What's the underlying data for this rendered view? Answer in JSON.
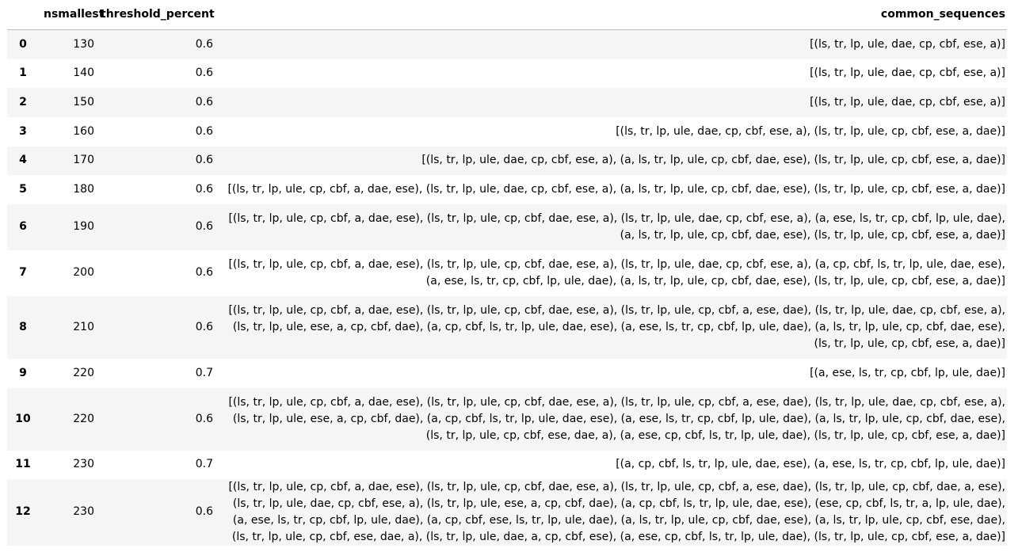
{
  "table": {
    "columns": [
      "",
      "nsmallest",
      "threshold_percent",
      "common_sequences"
    ],
    "rows": [
      {
        "index": "0",
        "nsmallest": "130",
        "threshold_percent": "0.6",
        "common_sequences": "[(ls, tr, lp, ule, dae, cp, cbf, ese, a)]"
      },
      {
        "index": "1",
        "nsmallest": "140",
        "threshold_percent": "0.6",
        "common_sequences": "[(ls, tr, lp, ule, dae, cp, cbf, ese, a)]"
      },
      {
        "index": "2",
        "nsmallest": "150",
        "threshold_percent": "0.6",
        "common_sequences": "[(ls, tr, lp, ule, dae, cp, cbf, ese, a)]"
      },
      {
        "index": "3",
        "nsmallest": "160",
        "threshold_percent": "0.6",
        "common_sequences": "[(ls, tr, lp, ule, dae, cp, cbf, ese, a), (ls, tr, lp, ule, cp, cbf, ese, a, dae)]"
      },
      {
        "index": "4",
        "nsmallest": "170",
        "threshold_percent": "0.6",
        "common_sequences": "[(ls, tr, lp, ule, dae, cp, cbf, ese, a), (a, ls, tr, lp, ule, cp, cbf, dae, ese), (ls, tr, lp, ule, cp, cbf, ese, a, dae)]"
      },
      {
        "index": "5",
        "nsmallest": "180",
        "threshold_percent": "0.6",
        "common_sequences": "[(ls, tr, lp, ule, cp, cbf, a, dae, ese), (ls, tr, lp, ule, dae, cp, cbf, ese, a), (a, ls, tr, lp, ule, cp, cbf, dae, ese), (ls, tr, lp, ule, cp, cbf, ese, a, dae)]"
      },
      {
        "index": "6",
        "nsmallest": "190",
        "threshold_percent": "0.6",
        "common_sequences": "[(ls, tr, lp, ule, cp, cbf, a, dae, ese), (ls, tr, lp, ule, cp, cbf, dae, ese, a), (ls, tr, lp, ule, dae, cp, cbf, ese, a), (a, ese, ls, tr, cp, cbf, lp, ule, dae), (a, ls, tr, lp, ule, cp, cbf, dae, ese), (ls, tr, lp, ule, cp, cbf, ese, a, dae)]"
      },
      {
        "index": "7",
        "nsmallest": "200",
        "threshold_percent": "0.6",
        "common_sequences": "[(ls, tr, lp, ule, cp, cbf, a, dae, ese), (ls, tr, lp, ule, cp, cbf, dae, ese, a), (ls, tr, lp, ule, dae, cp, cbf, ese, a), (a, cp, cbf, ls, tr, lp, ule, dae, ese), (a, ese, ls, tr, cp, cbf, lp, ule, dae), (a, ls, tr, lp, ule, cp, cbf, dae, ese), (ls, tr, lp, ule, cp, cbf, ese, a, dae)]"
      },
      {
        "index": "8",
        "nsmallest": "210",
        "threshold_percent": "0.6",
        "common_sequences": "[(ls, tr, lp, ule, cp, cbf, a, dae, ese), (ls, tr, lp, ule, cp, cbf, dae, ese, a), (ls, tr, lp, ule, cp, cbf, a, ese, dae), (ls, tr, lp, ule, dae, cp, cbf, ese, a), (ls, tr, lp, ule, ese, a, cp, cbf, dae), (a, cp, cbf, ls, tr, lp, ule, dae, ese), (a, ese, ls, tr, cp, cbf, lp, ule, dae), (a, ls, tr, lp, ule, cp, cbf, dae, ese), (ls, tr, lp, ule, cp, cbf, ese, a, dae)]"
      },
      {
        "index": "9",
        "nsmallest": "220",
        "threshold_percent": "0.7",
        "common_sequences": "[(a, ese, ls, tr, cp, cbf, lp, ule, dae)]"
      },
      {
        "index": "10",
        "nsmallest": "220",
        "threshold_percent": "0.6",
        "common_sequences": "[(ls, tr, lp, ule, cp, cbf, a, dae, ese), (ls, tr, lp, ule, cp, cbf, dae, ese, a), (ls, tr, lp, ule, cp, cbf, a, ese, dae), (ls, tr, lp, ule, dae, cp, cbf, ese, a), (ls, tr, lp, ule, ese, a, cp, cbf, dae), (a, cp, cbf, ls, tr, lp, ule, dae, ese), (a, ese, ls, tr, cp, cbf, lp, ule, dae), (a, ls, tr, lp, ule, cp, cbf, dae, ese), (ls, tr, lp, ule, cp, cbf, ese, dae, a), (a, ese, cp, cbf, ls, tr, lp, ule, dae), (ls, tr, lp, ule, cp, cbf, ese, a, dae)]"
      },
      {
        "index": "11",
        "nsmallest": "230",
        "threshold_percent": "0.7",
        "common_sequences": "[(a, cp, cbf, ls, tr, lp, ule, dae, ese), (a, ese, ls, tr, cp, cbf, lp, ule, dae)]"
      },
      {
        "index": "12",
        "nsmallest": "230",
        "threshold_percent": "0.6",
        "common_sequences": "[(ls, tr, lp, ule, cp, cbf, a, dae, ese), (ls, tr, lp, ule, cp, cbf, dae, ese, a), (ls, tr, lp, ule, cp, cbf, a, ese, dae), (ls, tr, lp, ule, cp, cbf, dae, a, ese), (ls, tr, lp, ule, dae, cp, cbf, ese, a), (ls, tr, lp, ule, ese, a, cp, cbf, dae), (a, cp, cbf, ls, tr, lp, ule, dae, ese), (ese, cp, cbf, ls, tr, a, lp, ule, dae), (a, ese, ls, tr, cp, cbf, lp, ule, dae), (a, cp, cbf, ese, ls, tr, lp, ule, dae), (a, ls, tr, lp, ule, cp, cbf, dae, ese), (a, ls, tr, lp, ule, cp, cbf, ese, dae), (ls, tr, lp, ule, cp, cbf, ese, dae, a), (ls, tr, lp, ule, dae, a, cp, cbf, ese), (a, ese, cp, cbf, ls, tr, lp, ule, dae), (ls, tr, lp, ule, cp, cbf, ese, a, dae)]"
      }
    ]
  }
}
